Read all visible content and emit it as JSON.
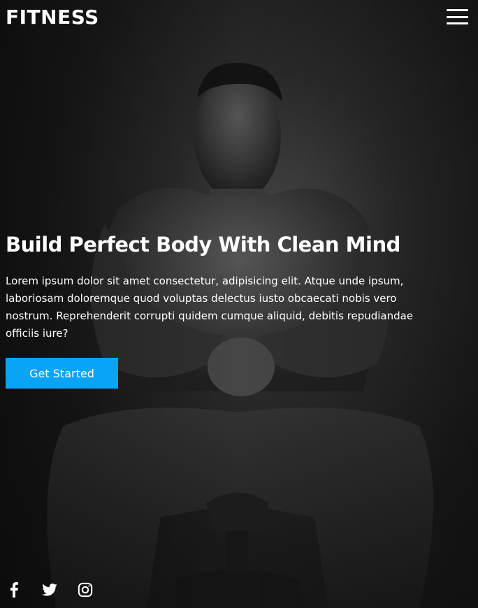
{
  "brand": {
    "logo_text": "FITNESS"
  },
  "nav": {
    "menu_icon": "hamburger-menu-icon"
  },
  "hero": {
    "headline": "Build Perfect Body With Clean Mind",
    "body": "Lorem ipsum dolor sit amet consectetur, adipisicing elit. Atque unde ipsum, laboriosam doloremque quod voluptas delectus iusto obcaecati nobis vero nostrum. Reprehenderit corrupti quidem cumque aliquid, debitis repudiandae officiis iure?",
    "cta_label": "Get Started",
    "background_image": "man-sitting-on-exercise-bike-photo"
  },
  "social": [
    {
      "icon": "facebook-icon"
    },
    {
      "icon": "twitter-icon"
    },
    {
      "icon": "instagram-icon"
    }
  ],
  "colors": {
    "accent": "#0aa4f6",
    "text": "#ffffff",
    "background": "#1b1b1b"
  }
}
